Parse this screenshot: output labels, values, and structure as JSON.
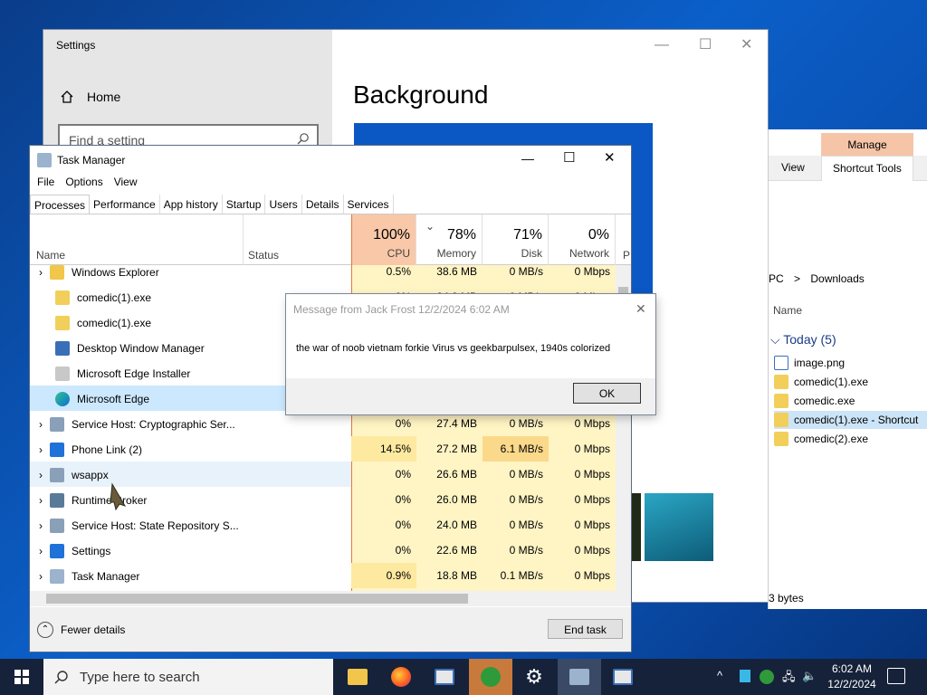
{
  "settings": {
    "title": "Settings",
    "home": "Home",
    "search_placeholder": "Find a setting",
    "heading": "Background"
  },
  "explorer": {
    "ribbon_context": "Manage",
    "tabs": [
      "View",
      "Shortcut Tools"
    ],
    "breadcrumb_prefix": "PC",
    "breadcrumb_sep": ">",
    "breadcrumb_folder": "Downloads",
    "column_name": "Name",
    "group_label": "Today (5)",
    "files": [
      "image.png",
      "comedic(1).exe",
      "comedic.exe",
      "comedic(1).exe - Shortcut",
      "comedic(2).exe"
    ],
    "status": "3 bytes"
  },
  "taskmanager": {
    "title": "Task Manager",
    "menu": [
      "File",
      "Options",
      "View"
    ],
    "tabs": [
      "Processes",
      "Performance",
      "App history",
      "Startup",
      "Users",
      "Details",
      "Services"
    ],
    "columns": {
      "name": "Name",
      "status": "Status",
      "cpu_pct": "100%",
      "cpu": "CPU",
      "mem_pct": "78%",
      "mem": "Memory",
      "disk_pct": "71%",
      "disk": "Disk",
      "net_pct": "0%",
      "net": "Network",
      "power": "P"
    },
    "rows": [
      {
        "name": "Windows Explorer",
        "cpu": "0.5%",
        "mem": "38.6 MB",
        "disk": "0 MB/s",
        "net": "0 Mbps"
      },
      {
        "name": "comedic(1).exe",
        "cpu": "0%",
        "mem": "24.8 MB",
        "disk": "0 MB/s",
        "net": "0 Mbps"
      },
      {
        "name": "comedic(1).exe",
        "cpu": "",
        "mem": "",
        "disk": "",
        "net": ""
      },
      {
        "name": "Desktop Window Manager",
        "cpu": "",
        "mem": "",
        "disk": "",
        "net": ""
      },
      {
        "name": "Microsoft Edge Installer",
        "cpu": "",
        "mem": "",
        "disk": "",
        "net": ""
      },
      {
        "name": "Microsoft Edge",
        "cpu": "",
        "mem": "",
        "disk": "",
        "net": ""
      },
      {
        "name": "Service Host: Cryptographic Ser...",
        "cpu": "0%",
        "mem": "27.4 MB",
        "disk": "0 MB/s",
        "net": "0 Mbps"
      },
      {
        "name": "Phone Link (2)",
        "cpu": "14.5%",
        "mem": "27.2 MB",
        "disk": "6.1 MB/s",
        "net": "0 Mbps"
      },
      {
        "name": "wsappx",
        "cpu": "0%",
        "mem": "26.6 MB",
        "disk": "0 MB/s",
        "net": "0 Mbps"
      },
      {
        "name": "Runtime Broker",
        "cpu": "0%",
        "mem": "26.0 MB",
        "disk": "0 MB/s",
        "net": "0 Mbps"
      },
      {
        "name": "Service Host: State Repository S...",
        "cpu": "0%",
        "mem": "24.0 MB",
        "disk": "0 MB/s",
        "net": "0 Mbps"
      },
      {
        "name": "Settings",
        "cpu": "0%",
        "mem": "22.6 MB",
        "disk": "0 MB/s",
        "net": "0 Mbps"
      },
      {
        "name": "Task Manager",
        "cpu": "0.9%",
        "mem": "18.8 MB",
        "disk": "0.1 MB/s",
        "net": "0 Mbps"
      }
    ],
    "fewer_details": "Fewer details",
    "end_task": "End task"
  },
  "dialog": {
    "title": "Message from Jack Frost 12/2/2024 6:02 AM",
    "message": "the war of noob vietnam forkie Virus vs geekbarpulsex, 1940s colorized",
    "ok": "OK"
  },
  "taskbar": {
    "search_placeholder": "Type here to search",
    "time": "6:02 AM",
    "date": "12/2/2024"
  },
  "colors": {
    "cpu_header": "#f8c8a8",
    "heat_light": "#fff4c4",
    "heat_mid": "#fde9a0",
    "heat_hot": "#fbd98a",
    "selected_row": "#cce8ff",
    "taskbar": "#16223a"
  }
}
